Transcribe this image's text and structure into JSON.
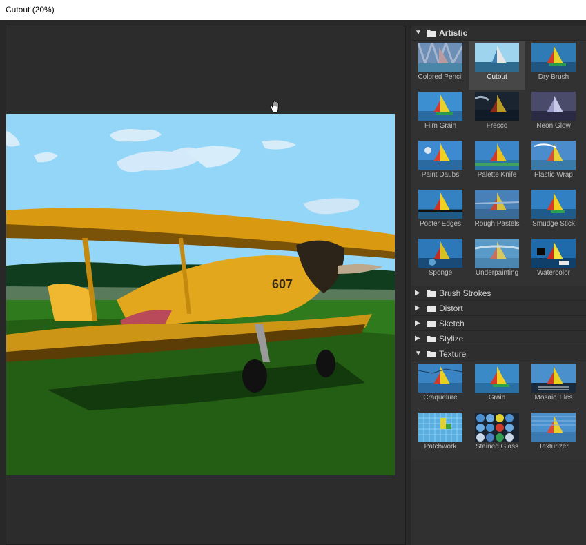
{
  "window": {
    "title": "Cutout (20%)"
  },
  "groups": [
    {
      "name": "Artistic",
      "expanded": true,
      "filters": [
        "Colored Pencil",
        "Cutout",
        "Dry Brush",
        "Film Grain",
        "Fresco",
        "Neon Glow",
        "Paint Daubs",
        "Palette Knife",
        "Plastic Wrap",
        "Poster Edges",
        "Rough Pastels",
        "Smudge Stick",
        "Sponge",
        "Underpainting",
        "Watercolor"
      ],
      "selected": 1
    },
    {
      "name": "Brush Strokes",
      "expanded": false,
      "filters": []
    },
    {
      "name": "Distort",
      "expanded": false,
      "filters": []
    },
    {
      "name": "Sketch",
      "expanded": false,
      "filters": []
    },
    {
      "name": "Stylize",
      "expanded": false,
      "filters": []
    },
    {
      "name": "Texture",
      "expanded": true,
      "filters": [
        "Craquelure",
        "Grain",
        "Mosaic Tiles",
        "Patchwork",
        "Stained Glass",
        "Texturizer"
      ],
      "selected": -1
    }
  ],
  "icons": {
    "expanded": "triangle-down-icon",
    "collapsed": "triangle-right-icon",
    "folder": "folder-icon",
    "cursor": "hand-cursor-icon"
  },
  "colors": {
    "panel_bg": "#303030",
    "selected_tile": "#474747",
    "sky": "#8fd3f7",
    "grass": "#2f7a1c",
    "plane": "#e0a317"
  }
}
